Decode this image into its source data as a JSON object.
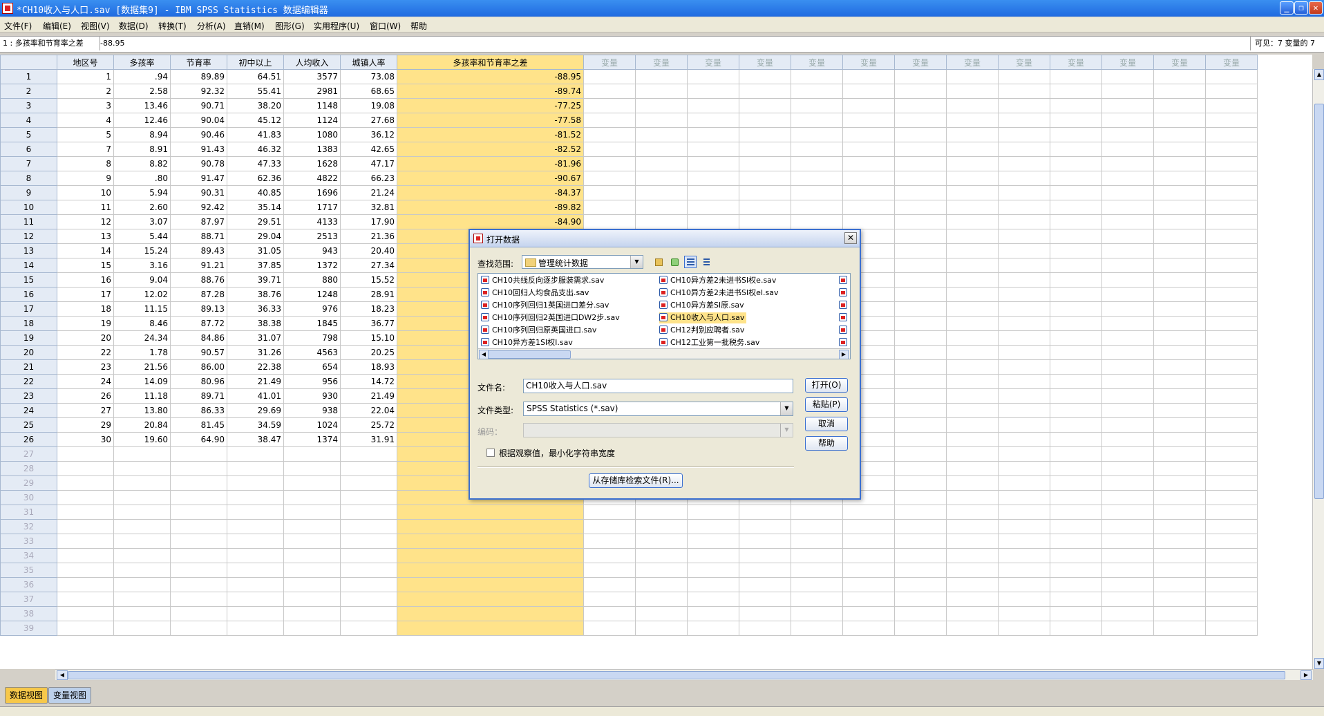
{
  "window": {
    "title": "*CH10收入与人口.sav [数据集9] - IBM SPSS Statistics 数据编辑器",
    "minimize": "_",
    "restore": "❐",
    "close": "✕"
  },
  "menu": [
    "文件(F)",
    "编辑(E)",
    "视图(V)",
    "数据(D)",
    "转换(T)",
    "分析(A)",
    "直销(M)",
    "图形(G)",
    "实用程序(U)",
    "窗口(W)",
    "帮助"
  ],
  "editor": {
    "cell_ref": "1 : 多孩率和节育率之差",
    "cell_value": "-88.95",
    "visible": "可见：7 变量的 7"
  },
  "grid": {
    "columns": [
      "地区号",
      "多孩率",
      "节育率",
      "初中以上",
      "人均收入",
      "城镇人率",
      "多孩率和节育率之差"
    ],
    "empty_var_label": "变量",
    "empty_var_count": 13,
    "rows": [
      [
        "1",
        ".94",
        "89.89",
        "64.51",
        "3577",
        "73.08",
        "-88.95"
      ],
      [
        "2",
        "2.58",
        "92.32",
        "55.41",
        "2981",
        "68.65",
        "-89.74"
      ],
      [
        "3",
        "13.46",
        "90.71",
        "38.20",
        "1148",
        "19.08",
        "-77.25"
      ],
      [
        "4",
        "12.46",
        "90.04",
        "45.12",
        "1124",
        "27.68",
        "-77.58"
      ],
      [
        "5",
        "8.94",
        "90.46",
        "41.83",
        "1080",
        "36.12",
        "-81.52"
      ],
      [
        "7",
        "8.91",
        "91.43",
        "46.32",
        "1383",
        "42.65",
        "-82.52"
      ],
      [
        "8",
        "8.82",
        "90.78",
        "47.33",
        "1628",
        "47.17",
        "-81.96"
      ],
      [
        "9",
        ".80",
        "91.47",
        "62.36",
        "4822",
        "66.23",
        "-90.67"
      ],
      [
        "10",
        "5.94",
        "90.31",
        "40.85",
        "1696",
        "21.24",
        "-84.37"
      ],
      [
        "11",
        "2.60",
        "92.42",
        "35.14",
        "1717",
        "32.81",
        "-89.82"
      ],
      [
        "12",
        "3.07",
        "87.97",
        "29.51",
        "4133",
        "17.90",
        "-84.90"
      ],
      [
        "13",
        "5.44",
        "88.71",
        "29.04",
        "2513",
        "21.36",
        ""
      ],
      [
        "14",
        "15.24",
        "89.43",
        "31.05",
        "943",
        "20.40",
        ""
      ],
      [
        "15",
        "3.16",
        "91.21",
        "37.85",
        "1372",
        "27.34",
        ""
      ],
      [
        "16",
        "9.04",
        "88.76",
        "39.71",
        "880",
        "15.52",
        ""
      ],
      [
        "17",
        "12.02",
        "87.28",
        "38.76",
        "1248",
        "28.91",
        ""
      ],
      [
        "18",
        "11.15",
        "89.13",
        "36.33",
        "976",
        "18.23",
        ""
      ],
      [
        "19",
        "8.46",
        "87.72",
        "38.38",
        "1845",
        "36.77",
        ""
      ],
      [
        "20",
        "24.34",
        "84.86",
        "31.07",
        "798",
        "15.10",
        ""
      ],
      [
        "22",
        "1.78",
        "90.57",
        "31.26",
        "4563",
        "20.25",
        ""
      ],
      [
        "23",
        "21.56",
        "86.00",
        "22.38",
        "654",
        "18.93",
        ""
      ],
      [
        "24",
        "14.09",
        "80.96",
        "21.49",
        "956",
        "14.72",
        ""
      ],
      [
        "26",
        "11.18",
        "89.71",
        "41.01",
        "930",
        "21.49",
        ""
      ],
      [
        "27",
        "13.80",
        "86.33",
        "29.69",
        "938",
        "22.04",
        ""
      ],
      [
        "29",
        "20.84",
        "81.45",
        "34.59",
        "1024",
        "25.72",
        ""
      ],
      [
        "30",
        "19.60",
        "64.90",
        "38.47",
        "1374",
        "31.91",
        ""
      ]
    ],
    "blank_row_numbers": [
      "27",
      "28",
      "29",
      "30",
      "31",
      "32",
      "33",
      "34",
      "35",
      "36",
      "37",
      "38",
      "39"
    ],
    "highlight_color": "#ffe38a"
  },
  "tabs": {
    "data_view": "数据视图",
    "variable_view": "变量视图"
  },
  "dialog": {
    "title": "打开数据",
    "look_in_label": "查找范围:",
    "look_in_value": "管理统计数据",
    "toolbar_icons": [
      "up-folder-icon",
      "new-folder-icon",
      "list-view-icon",
      "details-view-icon"
    ],
    "files_col1": [
      "CH10共线反向逐步服装需求.sav",
      "CH10回归人均食品支出.sav",
      "CH10序列回归1英国进口差分.sav",
      "CH10序列回归2英国进口DW2步.sav",
      "CH10序列回归原英国进口.sav",
      "CH10异方差1SI权I.sav"
    ],
    "files_col2": [
      "CH10异方差2未进书SI权e.sav",
      "CH10异方差2未进书SI权el.sav",
      "CH10异方差SI原.sav",
      "CH10收入与人口.sav",
      "CH12判别应聘者.sav",
      "CH12工业第一批税务.sav"
    ],
    "selected_file": "CH10收入与人口.sav",
    "file_name_label": "文件名:",
    "file_name_value": "CH10收入与人口.sav",
    "file_type_label": "文件类型:",
    "file_type_value": "SPSS Statistics (*.sav)",
    "encoding_label": "编码：",
    "checkbox_label": "根据观察值，最小化字符串宽度",
    "buttons": {
      "open": "打开(O)",
      "paste": "粘贴(P)",
      "cancel": "取消",
      "help": "帮助",
      "repository": "从存储库检索文件(R)..."
    },
    "close": "✕"
  }
}
